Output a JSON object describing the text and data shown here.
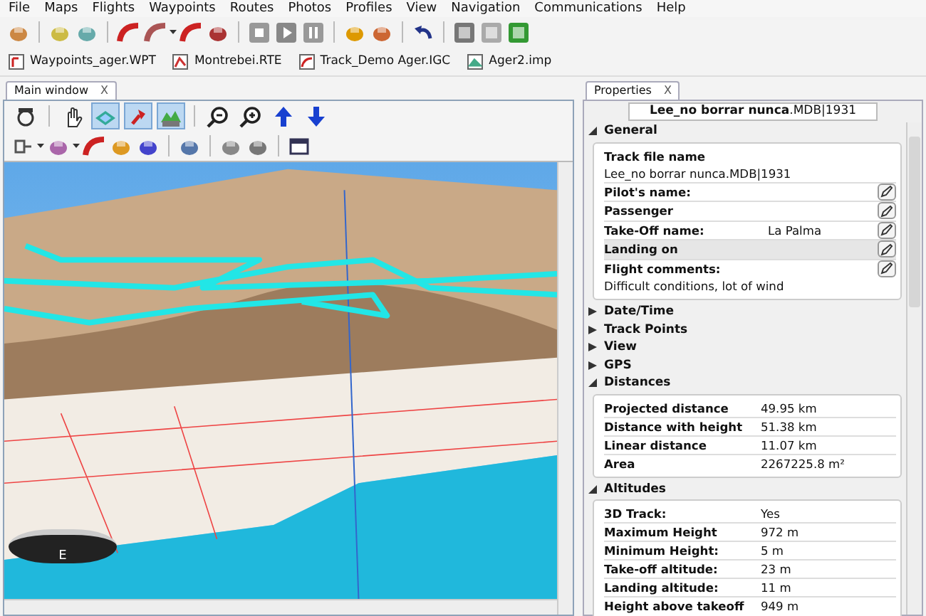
{
  "menu_bar": [
    "File",
    "Maps",
    "Flights",
    "Waypoints",
    "Routes",
    "Photos",
    "Profiles",
    "View",
    "Navigation",
    "Communications",
    "Help"
  ],
  "open_files": [
    {
      "name": "Waypoints_ager.WPT",
      "kind": "waypoints"
    },
    {
      "name": "Montrebei.RTE",
      "kind": "route"
    },
    {
      "name": "Track_Demo Ager.IGC",
      "kind": "track"
    },
    {
      "name": "Ager2.imp",
      "kind": "map"
    }
  ],
  "main_window": {
    "tab": {
      "title": "Main window",
      "close": "X",
      "selected": true
    },
    "toolbar": [
      {
        "kind": "zoom100",
        "selected": false
      },
      {
        "kind": "sep"
      },
      {
        "kind": "hand",
        "selected": false
      },
      {
        "kind": "map3d",
        "selected": true
      },
      {
        "kind": "pin",
        "selected": true
      },
      {
        "kind": "terrain",
        "selected": true
      },
      {
        "kind": "sep"
      },
      {
        "kind": "zoomout",
        "selected": false
      },
      {
        "kind": "zoomin",
        "selected": false
      },
      {
        "kind": "up",
        "selected": false
      },
      {
        "kind": "down",
        "selected": false
      }
    ],
    "compass_label": "E"
  },
  "properties": {
    "tab": {
      "title": "Properties",
      "close": "X",
      "selected": true
    },
    "header": "**Lee_no borrar nunca**.MDB|1931",
    "sections": [
      {
        "title": "General",
        "expanded": true,
        "kind": "general",
        "file_label": "Track file name",
        "file_value": "Lee_no borrar nunca.MDB|1931",
        "fields": [
          {
            "label": "Pilot's name:",
            "selected": false
          },
          {
            "label": "Passenger",
            "selected": false
          },
          {
            "label": "Take-Off name:",
            "value": "La Palma",
            "selected": false
          },
          {
            "label": "Landing on",
            "selected": true
          },
          {
            "label": "Flight comments:",
            "selected": false
          }
        ],
        "comment": "Difficult conditions, lot of wind"
      },
      {
        "title": "Date/Time",
        "expanded": false
      },
      {
        "title": "Track Points",
        "expanded": false
      },
      {
        "title": "View",
        "expanded": false
      },
      {
        "title": "GPS",
        "expanded": false
      },
      {
        "title": "Distances",
        "expanded": true,
        "kind": "table",
        "rows": [
          {
            "label": "Projected distance",
            "value": "49.95 km"
          },
          {
            "label": "Distance with height",
            "value": "51.38 km"
          },
          {
            "label": "Linear distance",
            "value": "11.07 km"
          },
          {
            "label": "Area",
            "value": "2267225.8 m²"
          }
        ]
      },
      {
        "title": "Altitudes",
        "expanded": true,
        "kind": "table",
        "rows": [
          {
            "label": "3D Track:",
            "value": "Yes"
          },
          {
            "label": "Maximum Height",
            "value": "972 m"
          },
          {
            "label": "Minimum Height:",
            "value": "5 m"
          },
          {
            "label": "Take-off altitude:",
            "value": "23 m"
          },
          {
            "label": "Landing altitude:",
            "value": "11 m"
          },
          {
            "label": "Height above takeoff",
            "value": "949 m"
          }
        ]
      }
    ]
  }
}
